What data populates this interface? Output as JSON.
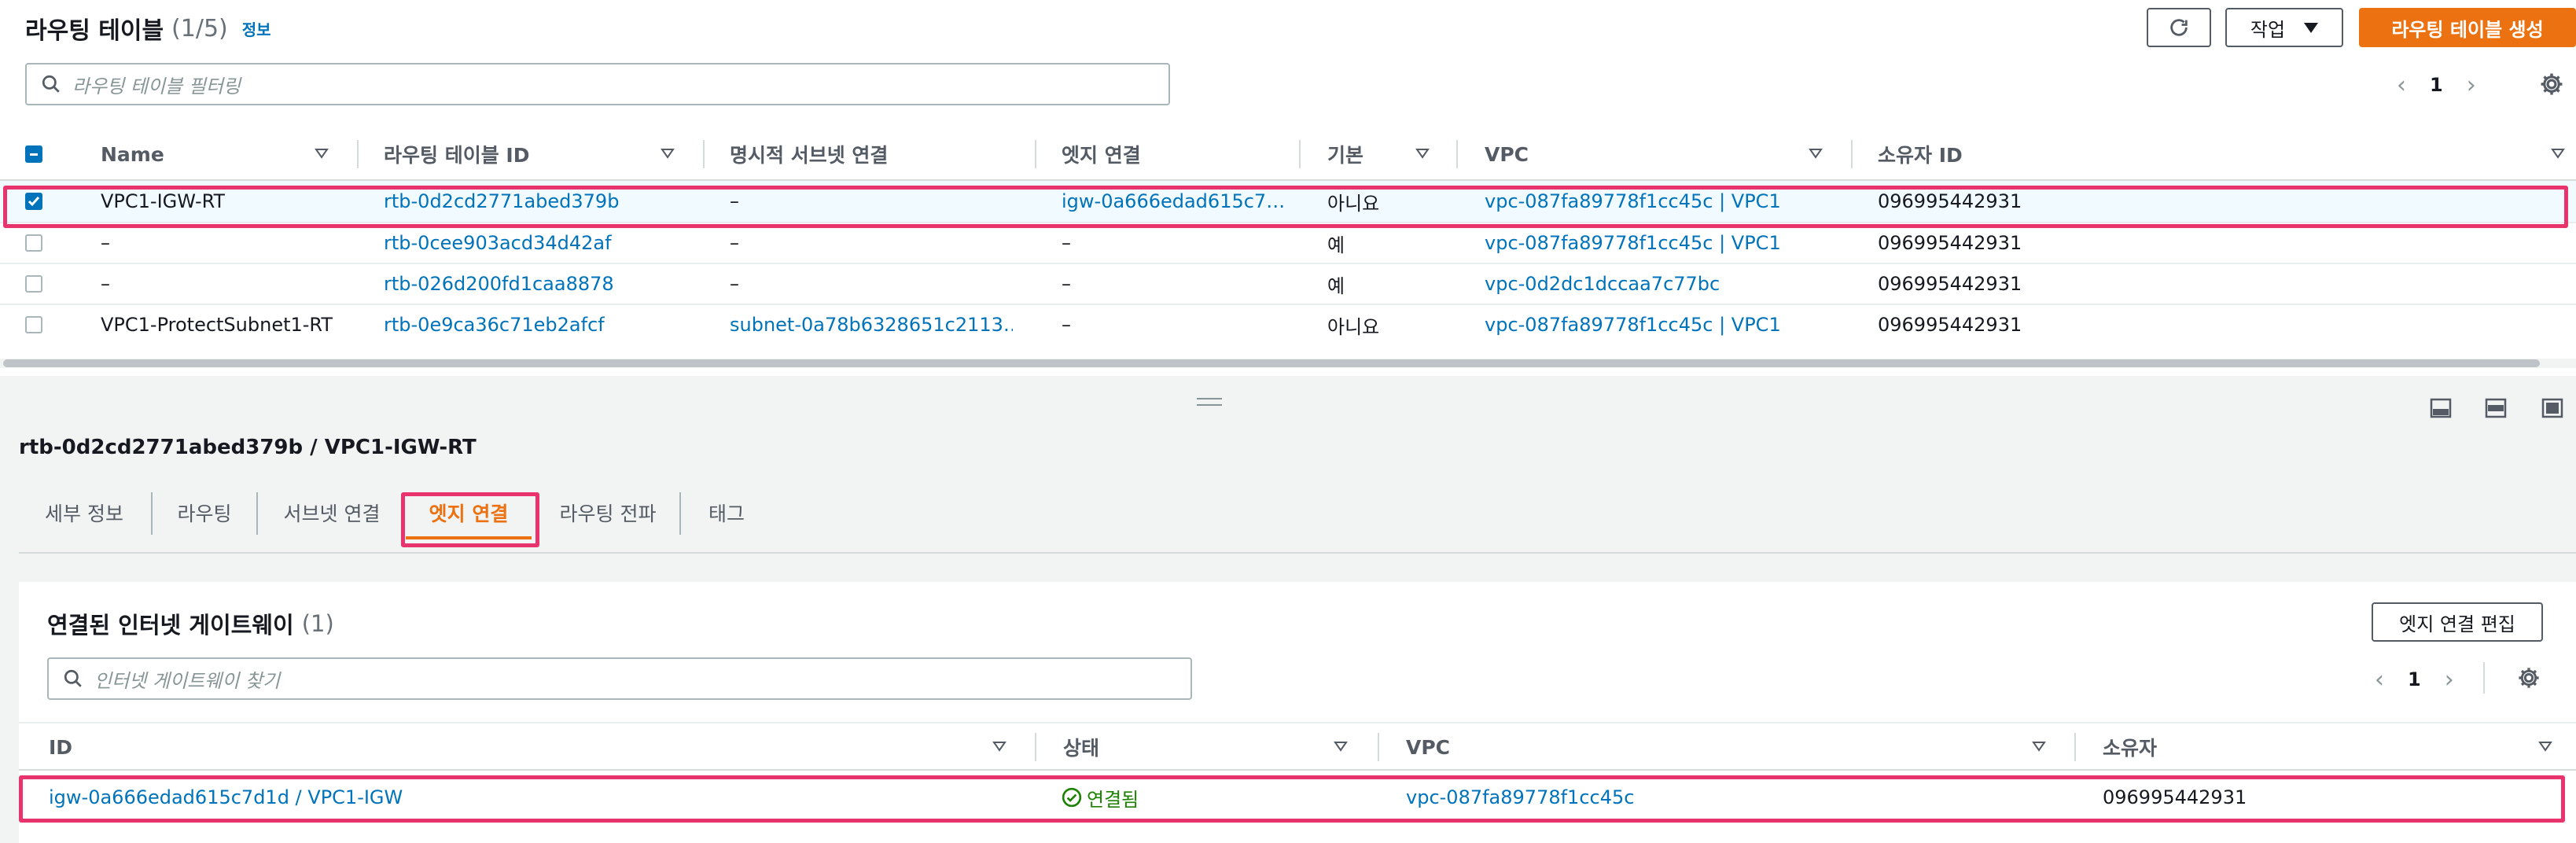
{
  "header": {
    "title": "라우팅 테이블",
    "count": "(1/5)",
    "info": "정보",
    "actions_label": "작업",
    "create_label": "라우팅 테이블 생성"
  },
  "search": {
    "placeholder": "라우팅 테이블 필터링"
  },
  "pager": {
    "page": "1"
  },
  "table": {
    "columns": [
      "Name",
      "라우팅 테이블 ID",
      "명시적 서브넷 연결",
      "엣지 연결",
      "기본",
      "VPC",
      "소유자 ID"
    ],
    "rows": [
      {
        "name": "VPC1-IGW-RT",
        "id": "rtb-0d2cd2771abed379b",
        "subnet": "–",
        "edge": "igw-0a666edad615c7…",
        "main": "아니요",
        "vpc": "vpc-087fa89778f1cc45c | VPC1",
        "owner": "096995442931",
        "checked": true
      },
      {
        "name": "–",
        "id": "rtb-0cee903acd34d42af",
        "subnet": "–",
        "edge": "–",
        "main": "예",
        "vpc": "vpc-087fa89778f1cc45c | VPC1",
        "owner": "096995442931",
        "checked": false
      },
      {
        "name": "–",
        "id": "rtb-026d200fd1caa8878",
        "subnet": "–",
        "edge": "–",
        "main": "예",
        "vpc": "vpc-0d2dc1dccaa7c77bc",
        "owner": "096995442931",
        "checked": false
      },
      {
        "name": "VPC1-ProtectSubnet1-RT",
        "id": "rtb-0e9ca36c71eb2afcf",
        "subnet": "subnet-0a78b6328651c2113…",
        "edge": "–",
        "main": "아니요",
        "vpc": "vpc-087fa89778f1cc45c | VPC1",
        "owner": "096995442931",
        "checked": false
      }
    ]
  },
  "detail": {
    "title": "rtb-0d2cd2771abed379b / VPC1-IGW-RT",
    "tabs": [
      "세부 정보",
      "라우팅",
      "서브넷 연결",
      "엣지 연결",
      "라우팅 전파",
      "태그"
    ],
    "active_tab": "엣지 연결"
  },
  "edge_panel": {
    "title": "연결된 인터넷 게이트웨이",
    "count": "(1)",
    "edit_label": "엣지 연결 편집",
    "search_placeholder": "인터넷 게이트웨이 찾기",
    "page": "1",
    "columns": [
      "ID",
      "상태",
      "VPC",
      "소유자"
    ],
    "rows": [
      {
        "id": "igw-0a666edad615c7d1d / VPC1-IGW",
        "status": "연결됨",
        "vpc": "vpc-087fa89778f1cc45c",
        "owner": "096995442931"
      }
    ]
  },
  "colors": {
    "accent": "#ec7211",
    "link": "#0073bb",
    "highlight": "#e8336d",
    "success": "#1d8102"
  }
}
